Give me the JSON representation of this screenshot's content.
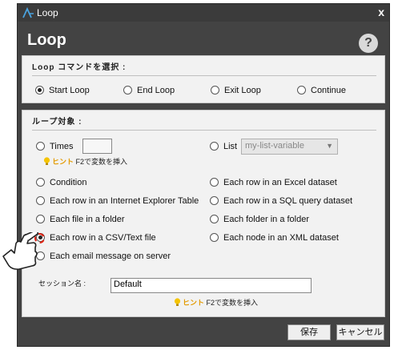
{
  "window": {
    "title": "Loop",
    "close_label": "x"
  },
  "heading": "Loop",
  "help_label": "?",
  "loop_command": {
    "title": "Loop コマンドを選択 :",
    "options": [
      {
        "label": "Start Loop",
        "checked": true
      },
      {
        "label": "End Loop",
        "checked": false
      },
      {
        "label": "Exit Loop",
        "checked": false
      },
      {
        "label": "Continue",
        "checked": false
      }
    ]
  },
  "loop_target": {
    "title": "ループ対象 :",
    "times_label": "Times",
    "times_value": "",
    "times_hint_word": "ヒント",
    "times_hint_text": "F2で変数を挿入",
    "list_label": "List",
    "list_selected": "my-list-variable",
    "left_options": [
      "Condition",
      "Each row in an Internet Explorer Table",
      "Each file in a folder",
      "Each row in a CSV/Text file",
      "Each email message on server"
    ],
    "right_options": [
      "Each row in an Excel dataset",
      "Each row in a SQL query dataset",
      "Each folder in a folder",
      "Each node in an XML dataset"
    ],
    "session_label": "セッション名 :",
    "session_value": "Default",
    "session_hint_word": "ヒント",
    "session_hint_text": "F2で変数を挿入"
  },
  "buttons": {
    "save": "保存",
    "cancel": "キャンセル"
  },
  "colors": {
    "window_bg": "#434343",
    "panel_bg": "#f2f2f2",
    "hint_accent": "#e39a00",
    "focus_ring": "#dd1111"
  }
}
